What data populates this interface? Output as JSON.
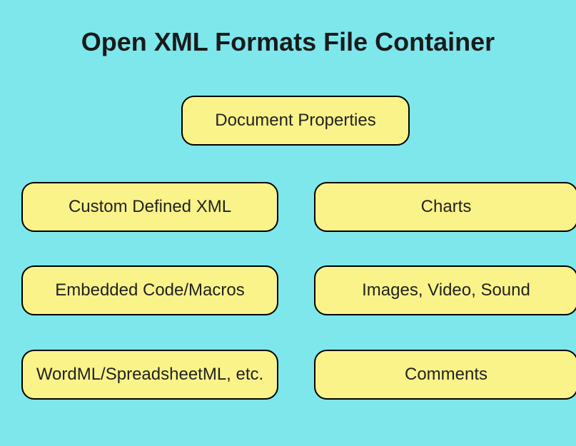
{
  "title": "Open XML Formats File Container",
  "boxes": {
    "top": "Document Properties",
    "left1": "Custom Defined XML",
    "left2": "Embedded Code/Macros",
    "left3": "WordML/SpreadsheetML, etc.",
    "right1": "Charts",
    "right2": "Images, Video, Sound",
    "right3": "Comments"
  },
  "colors": {
    "background": "#7de7ec",
    "boxFill": "#faf389",
    "boxBorder": "#000000",
    "text": "#1a1a1a"
  }
}
